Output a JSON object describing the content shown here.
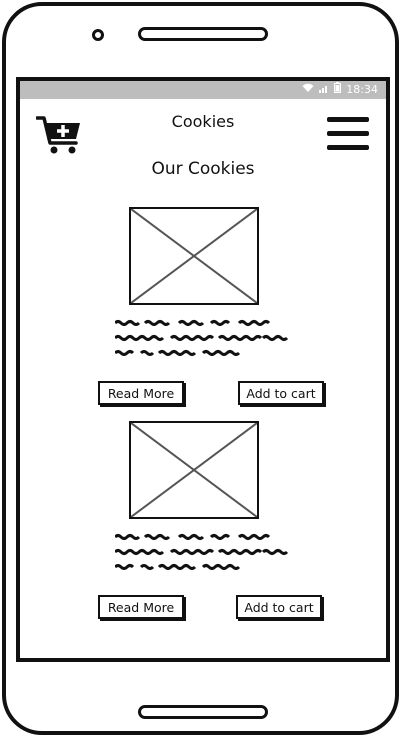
{
  "status_bar": {
    "time": "18:34",
    "icons": [
      "wifi-icon",
      "signal-icon",
      "battery-icon"
    ]
  },
  "header": {
    "title": "Cookies",
    "cart_icon": "add-to-cart-icon",
    "menu_icon": "hamburger-menu-icon"
  },
  "page": {
    "heading": "Our Cookies"
  },
  "products": [
    {
      "read_more_label": "Read More",
      "add_to_cart_label": "Add to cart"
    },
    {
      "read_more_label": "Read More",
      "add_to_cart_label": "Add to cart"
    }
  ],
  "colors": {
    "status_bar": "#bdbdbd",
    "outline": "#111111"
  }
}
